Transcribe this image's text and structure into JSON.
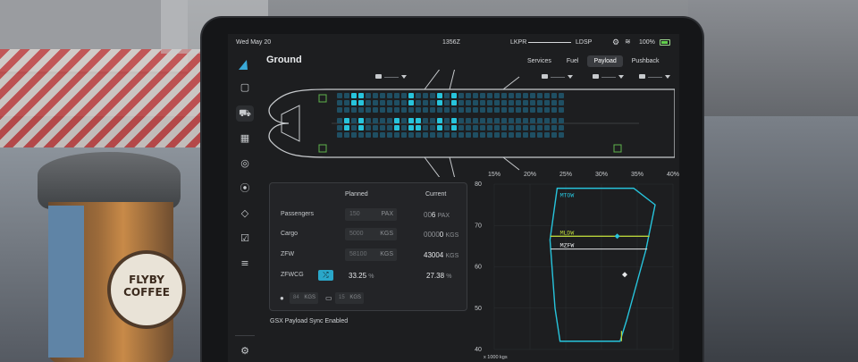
{
  "status": {
    "date": "Wed May 20",
    "time": "1356Z",
    "origin": "LKPR",
    "destination": "LDSP",
    "battery": "100%"
  },
  "sidebar": {
    "icons": [
      "clipboard-icon",
      "truck-icon",
      "calculator-icon",
      "compass-icon",
      "radio-icon",
      "warning-icon",
      "checklist-icon",
      "sliders-icon",
      "settings-icon"
    ]
  },
  "page": {
    "title": "Ground",
    "tabs": [
      "Services",
      "Fuel",
      "Payload",
      "Pushback"
    ],
    "active_tab": "Payload"
  },
  "payload": {
    "headers": {
      "planned": "Planned",
      "current": "Current"
    },
    "rows": [
      {
        "label": "Passengers",
        "planned": "150",
        "planned_unit": "PAX",
        "current_dim": "00",
        "current": "6",
        "current_unit": "PAX"
      },
      {
        "label": "Cargo",
        "planned": "5000",
        "planned_unit": "KGS",
        "current_dim": "0000",
        "current": "0",
        "current_unit": "KGS"
      },
      {
        "label": "ZFW",
        "planned": "58100",
        "planned_unit": "KGS",
        "current_dim": "",
        "current": "43004",
        "current_unit": "KGS"
      }
    ],
    "zfwcg": {
      "label": "ZFWCG",
      "planned": "33.25",
      "current": "27.38",
      "unit": "%"
    },
    "pax_weight": {
      "value": "84",
      "unit": "KGS"
    },
    "bag_weight": {
      "value": "15",
      "unit": "KGS"
    }
  },
  "footer": {
    "sync": "GSX Payload Sync Enabled"
  },
  "chart_data": {
    "type": "scatter",
    "title": "",
    "xlabel": "",
    "ylabel": "x 1000 kgs",
    "x_ticks": [
      "15%",
      "20%",
      "25%",
      "30%",
      "35%",
      "40%"
    ],
    "y_ticks": [
      "80",
      "70",
      "60",
      "50",
      "40"
    ],
    "ylim": [
      40,
      80
    ],
    "limits": [
      {
        "name": "MTOW",
        "value": 79,
        "color": "#27c4dc"
      },
      {
        "name": "MLDW",
        "value": 67.4,
        "color": "#b7d23a"
      },
      {
        "name": "MZFW",
        "value": 64.3,
        "color": "#e6e8ea"
      }
    ],
    "points": [
      {
        "name": "planned",
        "cg": 33.25,
        "weight": 58.1,
        "color": "#e6e8ea"
      },
      {
        "name": "landing",
        "cg": 32.2,
        "weight": 67.4,
        "color": "#27c4dc"
      }
    ]
  },
  "aircraft": {
    "filled_seats_upper": [
      2,
      3,
      10,
      14,
      16
    ],
    "filled_seats_lower": [
      1,
      3,
      8,
      10,
      11,
      14,
      16
    ]
  }
}
